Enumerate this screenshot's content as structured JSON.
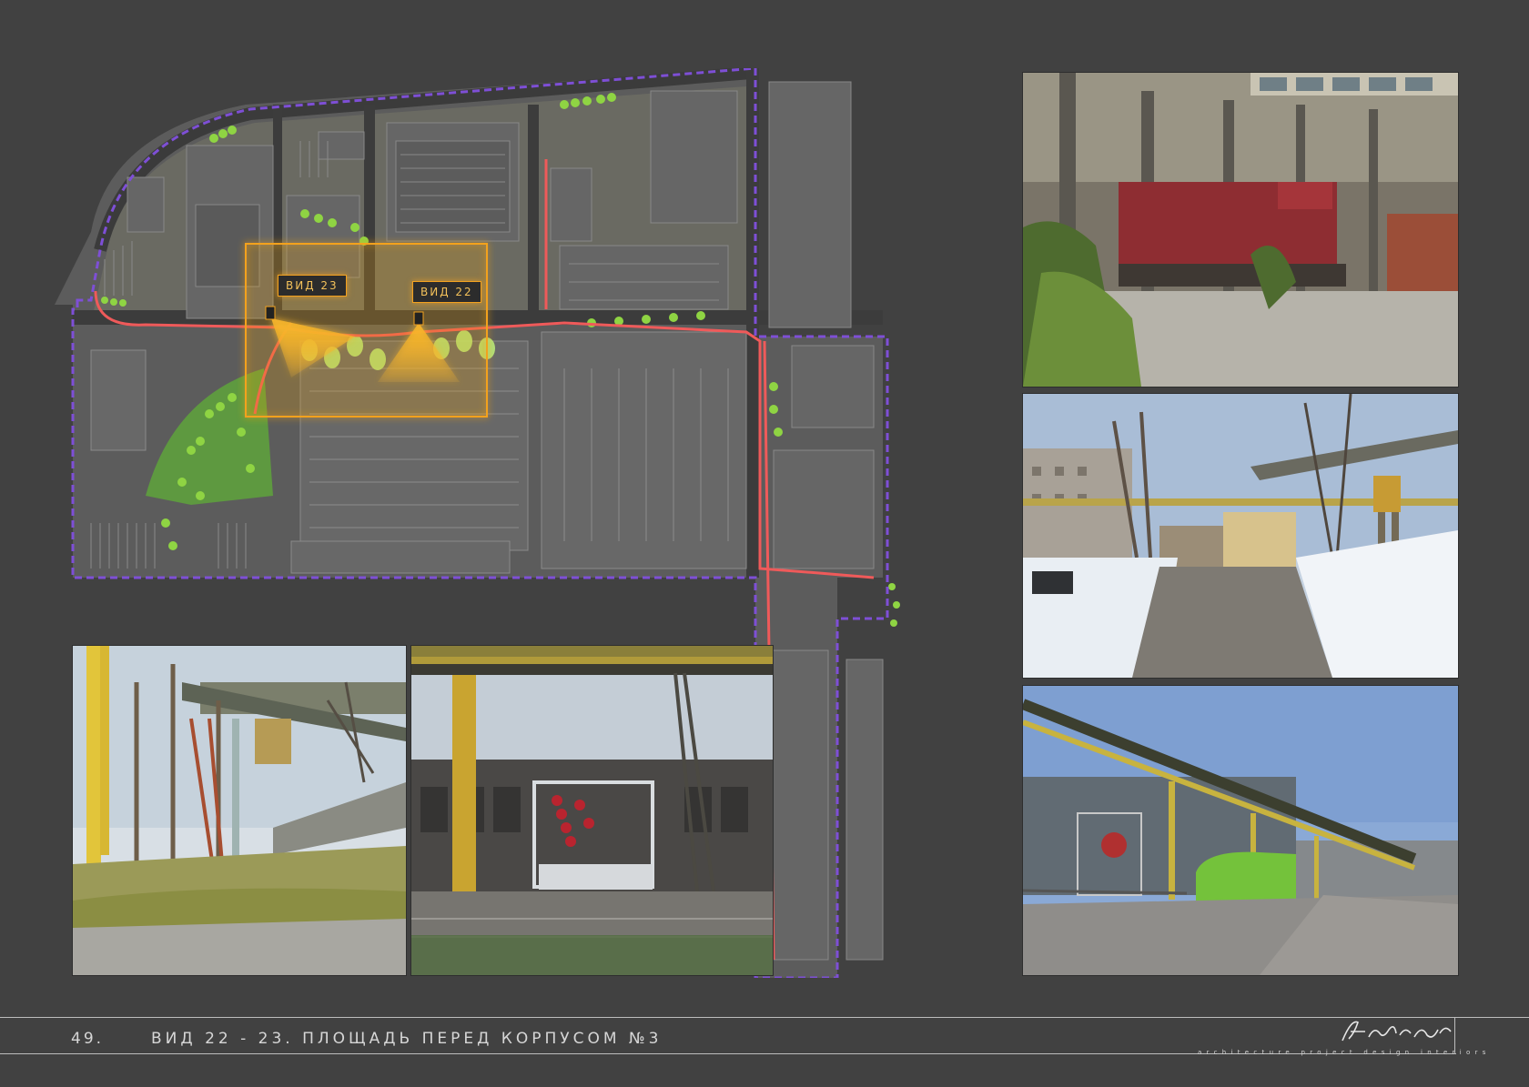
{
  "map": {
    "view_labels": [
      "ВИД 23",
      "ВИД 22"
    ],
    "colors": {
      "background": "#414141",
      "site": "#5a5a5a",
      "building": "#6b6b6b",
      "boundary": "#7e4fd6",
      "path": "#ef5a5a",
      "green": "#8fd443",
      "view_highlight": "#f3a21f"
    }
  },
  "photos": [
    {
      "name": "photo-locomotive",
      "subject": "red diesel locomotive in factory yard"
    },
    {
      "name": "photo-winter-street",
      "subject": "snowy street with pipeline overpass"
    },
    {
      "name": "photo-pipeline-street",
      "subject": "street under pipeline with green bus"
    },
    {
      "name": "photo-crane",
      "subject": "gantry crane and yellow gas pipe"
    },
    {
      "name": "photo-stage",
      "subject": "stage truss in front of factory building"
    }
  ],
  "footer": {
    "page_number": "49.",
    "title": "ВИД 22 - 23. ПЛОЩАДЬ ПЕРЕД КОРПУСОМ №3",
    "brand": "Archigraph",
    "tagline": "architecture project design interiors"
  }
}
